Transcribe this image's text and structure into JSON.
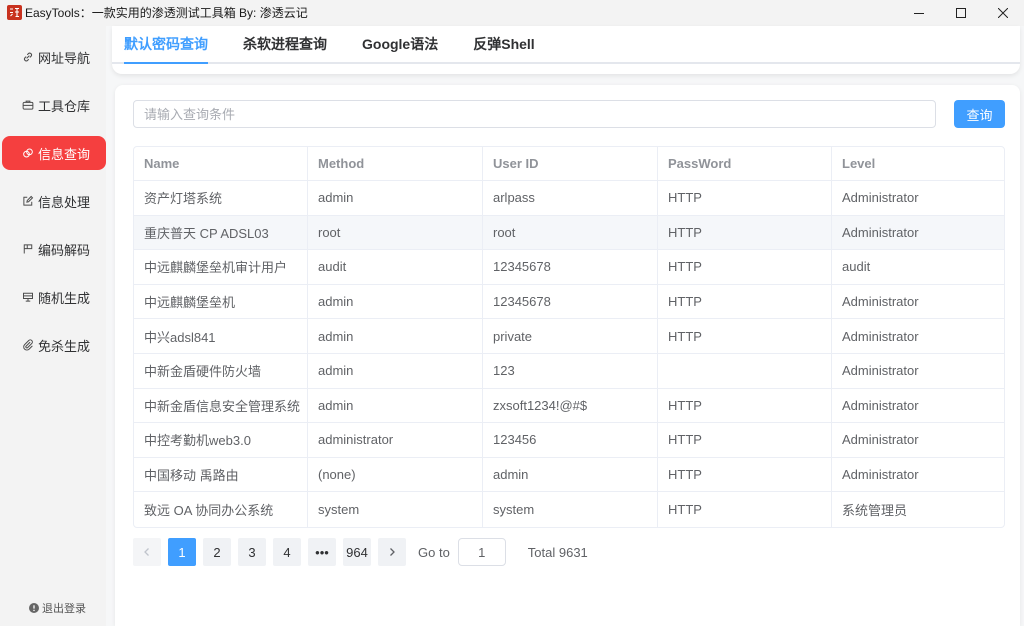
{
  "window": {
    "title": "EasyTools：一款实用的渗透测试工具箱 By: 渗透云记",
    "controls": [
      "minimize-icon",
      "maximize-icon",
      "close-icon"
    ]
  },
  "sidebar": {
    "items": [
      {
        "label": "网址导航",
        "icon": "link-icon",
        "active": false
      },
      {
        "label": "工具仓库",
        "icon": "briefcase-icon",
        "active": false
      },
      {
        "label": "信息查询",
        "icon": "link-rings-icon",
        "active": true
      },
      {
        "label": "信息处理",
        "icon": "edit-icon",
        "active": false
      },
      {
        "label": "编码解码",
        "icon": "flag-icon",
        "active": false
      },
      {
        "label": "随机生成",
        "icon": "box-icon",
        "active": false
      },
      {
        "label": "免杀生成",
        "icon": "paperclip-icon",
        "active": false
      }
    ],
    "logout": {
      "label": "退出登录",
      "icon": "info-circle-icon"
    }
  },
  "tabs": [
    {
      "label": "默认密码查询",
      "active": true
    },
    {
      "label": "杀软进程查询",
      "active": false
    },
    {
      "label": "Google语法",
      "active": false
    },
    {
      "label": "反弹Shell",
      "active": false
    }
  ],
  "search": {
    "placeholder": "请输入查询条件",
    "button_label": "查询"
  },
  "table": {
    "columns": [
      "Name",
      "Method",
      "User ID",
      "PassWord",
      "Level"
    ],
    "rows": [
      [
        "资产灯塔系统",
        "admin",
        "arlpass",
        "HTTP",
        "Administrator"
      ],
      [
        "重庆普天 CP ADSL03",
        "root",
        "root",
        "HTTP",
        "Administrator"
      ],
      [
        "中远麒麟堡垒机审计用户",
        "audit",
        "12345678",
        "HTTP",
        "audit"
      ],
      [
        "中远麒麟堡垒机",
        "admin",
        "12345678",
        "HTTP",
        "Administrator"
      ],
      [
        "中兴adsl841",
        "admin",
        "private",
        "HTTP",
        "Administrator"
      ],
      [
        "中新金盾硬件防火墙",
        "admin",
        "123",
        "",
        "Administrator"
      ],
      [
        "中新金盾信息安全管理系统",
        "admin",
        "zxsoft1234!@#$",
        "HTTP",
        "Administrator"
      ],
      [
        "中控考勤机web3.0",
        "administrator",
        "123456",
        "HTTP",
        "Administrator"
      ],
      [
        "中国移动 禹路由",
        "(none)",
        "admin",
        "HTTP",
        "Administrator"
      ],
      [
        "致远 OA 协同办公系统",
        "system",
        "system",
        "HTTP",
        "系统管理员"
      ]
    ]
  },
  "pagination": {
    "pages": [
      "1",
      "2",
      "3",
      "4",
      "•••",
      "964"
    ],
    "current": "1",
    "goto_label": "Go to",
    "goto_value": "1",
    "total": "Total 9631"
  },
  "colors": {
    "accent": "#409eff",
    "sidebar_active": "#f53f3f",
    "table_header_text": "#909399"
  }
}
